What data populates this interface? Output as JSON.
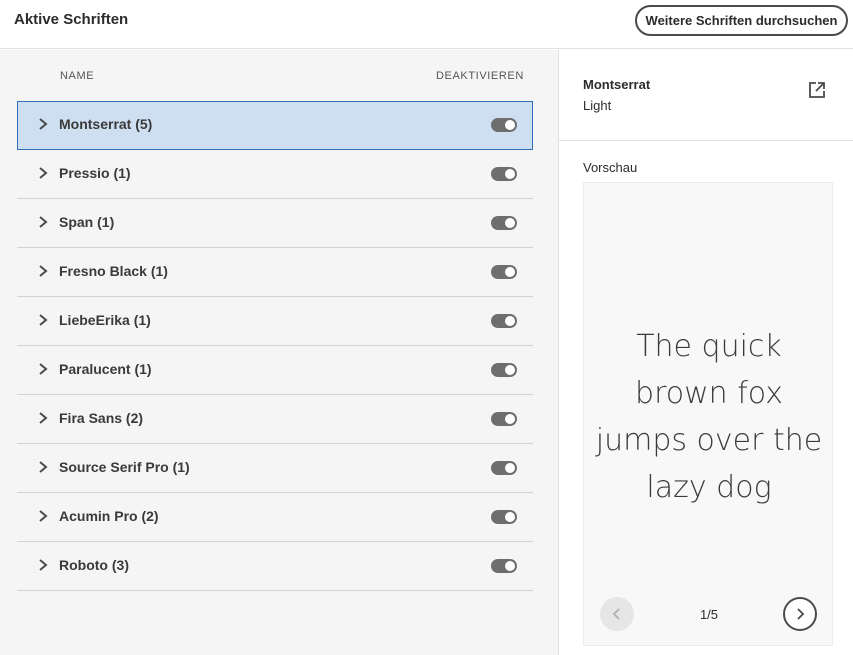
{
  "header": {
    "title": "Aktive Schriften",
    "browse_button": "Weitere Schriften durchsuchen"
  },
  "list": {
    "col_name": "NAME",
    "col_deactivate": "DEAKTIVIEREN",
    "items": [
      {
        "label": "Montserrat (5)",
        "selected": true,
        "active": true
      },
      {
        "label": "Pressio (1)",
        "active": true
      },
      {
        "label": "Span (1)",
        "active": true
      },
      {
        "label": "Fresno Black (1)",
        "active": true
      },
      {
        "label": "LiebeErika (1)",
        "active": true
      },
      {
        "label": "Paralucent (1)",
        "active": true
      },
      {
        "label": "Fira Sans (2)",
        "active": true
      },
      {
        "label": "Source Serif Pro (1)",
        "active": true
      },
      {
        "label": "Acumin Pro (2)",
        "active": true
      },
      {
        "label": "Roboto (3)",
        "active": true
      }
    ]
  },
  "detail": {
    "font_name": "Montserrat",
    "font_style": "Light",
    "preview_label": "Vorschau",
    "preview_text": "The quick brown fox jumps over the lazy dog",
    "pager": "1/5",
    "icons": {
      "open_external": "open-external-icon",
      "prev": "chevron-left-icon",
      "next": "chevron-right-icon"
    }
  },
  "colors": {
    "selected_row_bg": "#cddff0",
    "selected_row_border": "#2f6fb5",
    "toggle_on": "#6e6e6e"
  }
}
